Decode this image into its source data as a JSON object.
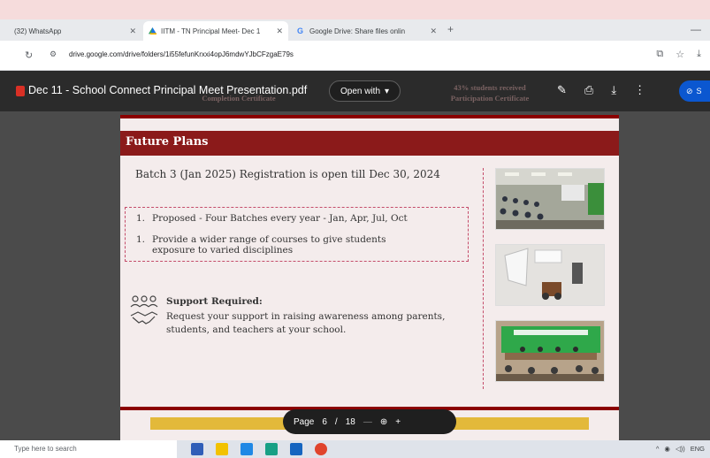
{
  "browser": {
    "tabs": [
      {
        "label": "(32) WhatsApp",
        "active": false,
        "favicon": "whatsapp-icon"
      },
      {
        "label": "IITM - TN Principal Meet- Dec 1",
        "active": true,
        "favicon": "google-drive-icon"
      },
      {
        "label": "Google Drive: Share files onlin",
        "active": false,
        "favicon": "google-icon"
      }
    ],
    "url": "drive.google.com/drive/folders/1i55fefunKrxxi4opJ6mdwYJbCFzgaE79s"
  },
  "viewer": {
    "file_title": "Dec 11 - School Connect Principal Meet Presentation.pdf",
    "open_with_label": "Open with",
    "share_label": "S",
    "ghost_left": "Completion Certificate",
    "ghost_right_1": "43% students received",
    "ghost_right_2": "Participation Certificate"
  },
  "slide": {
    "title": "Future Plans",
    "batch_line": "Batch 3 (Jan 2025) Registration is open till Dec 30, 2024",
    "plans": [
      {
        "num": "1.",
        "text": "Proposed - Four Batches every year - Jan, Apr, Jul, Oct"
      },
      {
        "num": "1.",
        "text": "Provide a wider range of courses to give students exposure to varied disciplines"
      }
    ],
    "support_title": "Support Required:",
    "support_body": "Request your support in raising awareness among parents, students, and teachers at your school."
  },
  "page_nav": {
    "label": "Page",
    "current": "6",
    "separator": "/",
    "total": "18",
    "minus": "—",
    "plus": "+"
  },
  "taskbar": {
    "search_placeholder": "Type here to search",
    "tray_lang": "ENG"
  },
  "colors": {
    "slide_header": "#8b1a1a",
    "accent_red": "#8b0000",
    "share_blue": "#0b57d0",
    "yellow": "#e3b93a"
  }
}
